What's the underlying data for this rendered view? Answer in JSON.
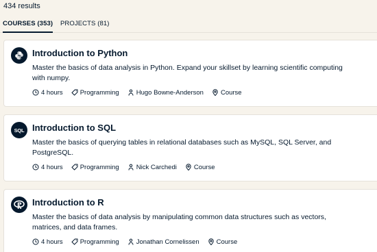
{
  "results": {
    "count_text": "434 results"
  },
  "tabs": [
    {
      "label": "COURSES (353)",
      "active": true
    },
    {
      "label": "PROJECTS (81)",
      "active": false
    }
  ],
  "courses": [
    {
      "title": "Introduction to Python",
      "description": "Master the basics of data analysis in Python. Expand your skillset by learning scientific computing with numpy.",
      "duration": "4 hours",
      "topic": "Programming",
      "instructor": "Hugo Bowne-Anderson",
      "type": "Course",
      "logo_icon": "python-logo-icon"
    },
    {
      "title": "Introduction to SQL",
      "description": "Master the basics of querying tables in relational databases such as MySQL, SQL Server, and PostgreSQL.",
      "duration": "4 hours",
      "topic": "Programming",
      "instructor": "Nick Carchedi",
      "type": "Course",
      "logo_icon": "sql-logo-icon",
      "logo_text": "SQL"
    },
    {
      "title": "Introduction to R",
      "description": "Master the basics of data analysis by manipulating common data structures such as vectors, matrices, and data frames.",
      "duration": "4 hours",
      "topic": "Programming",
      "instructor": "Jonathan Cornelissen",
      "type": "Course",
      "logo_icon": "r-logo-icon"
    }
  ],
  "colors": {
    "background": "#f7f3eb",
    "card": "#ffffff",
    "text": "#05192d",
    "border": "#e5e1da"
  }
}
